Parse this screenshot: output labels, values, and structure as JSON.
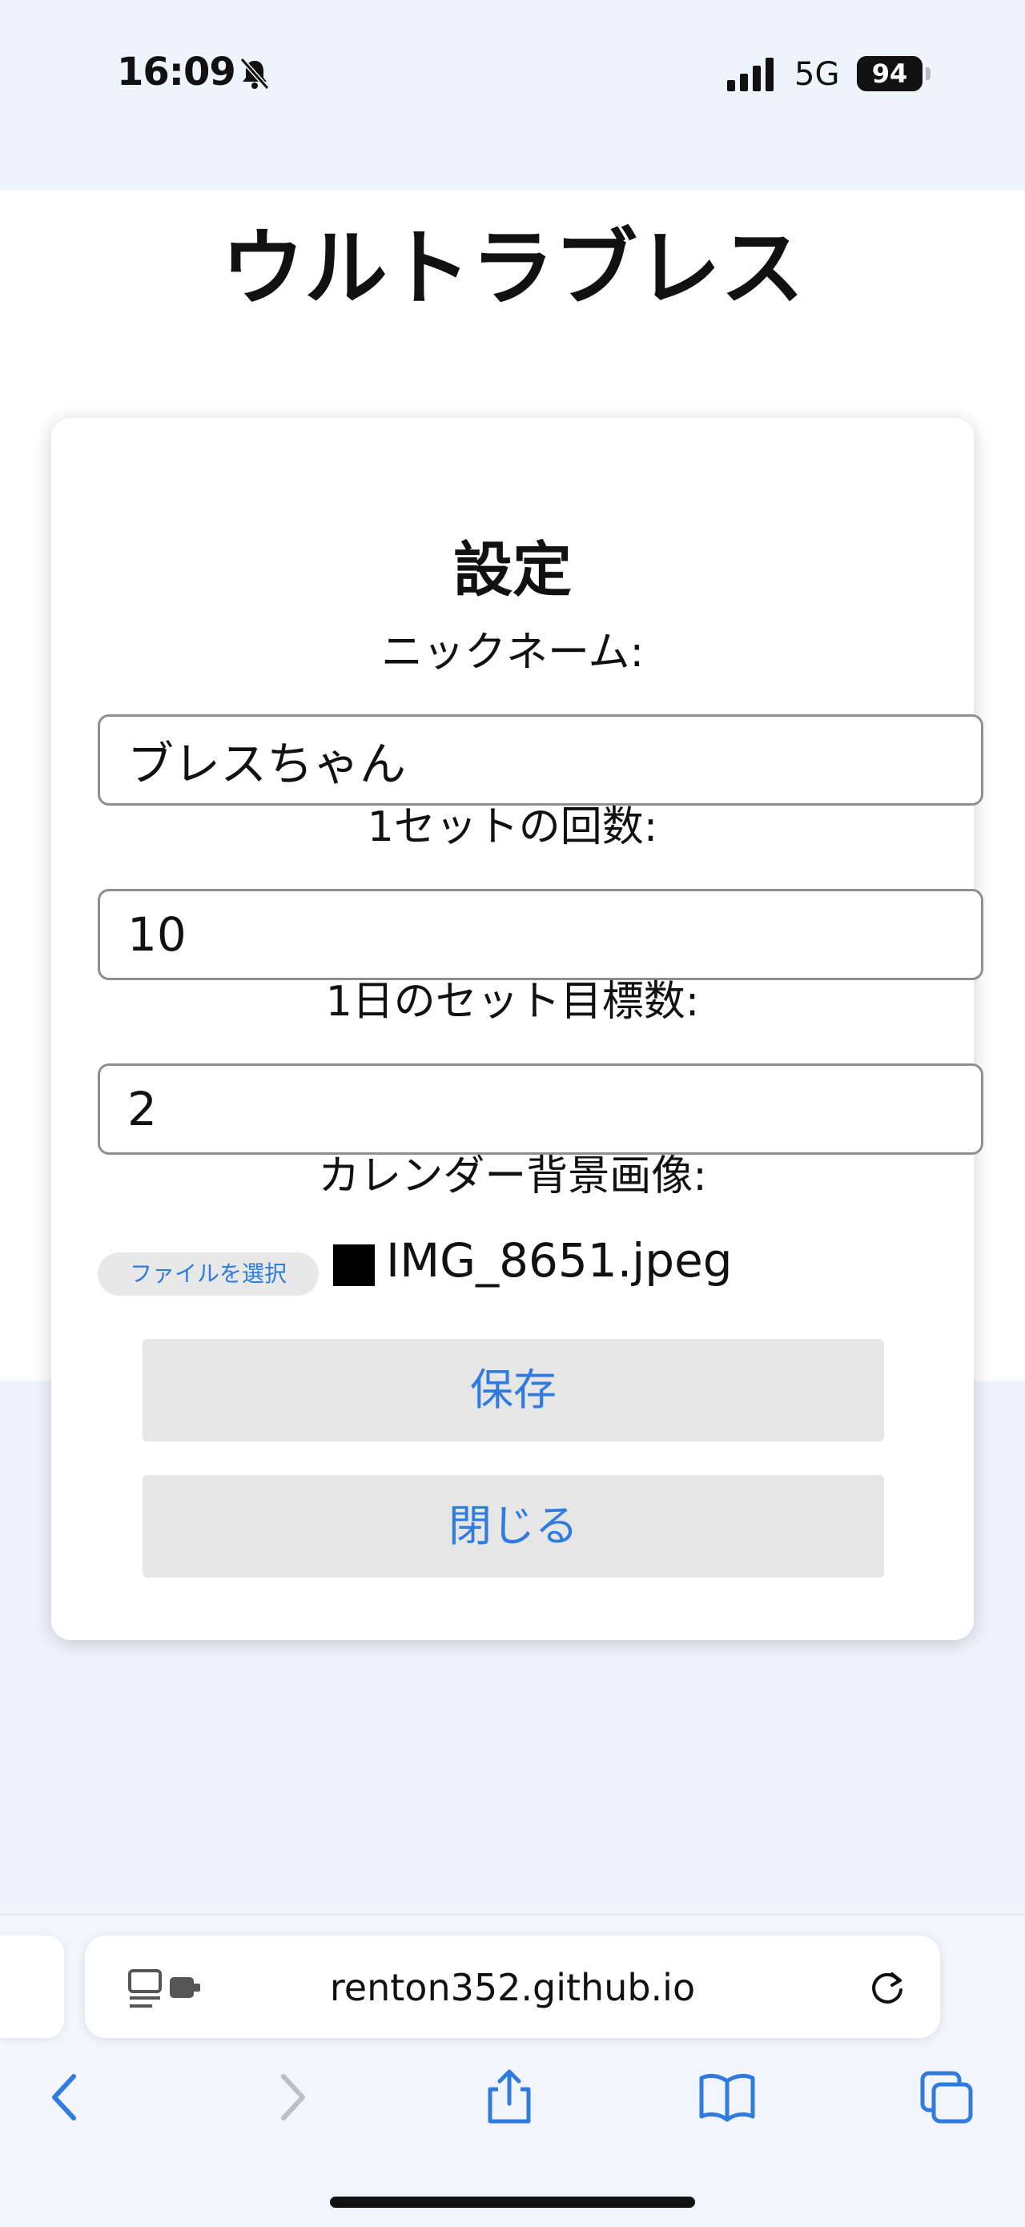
{
  "status_bar": {
    "time": "16:09",
    "network": "5G",
    "battery": "94",
    "icons": [
      "bell-slash-icon",
      "signal-bars-icon",
      "battery-icon"
    ]
  },
  "app": {
    "title": "ウルトラブレス"
  },
  "settings": {
    "title": "設定",
    "nickname": {
      "label": "ニックネーム:",
      "value": "ブレスちゃん"
    },
    "reps_per_set": {
      "label": "1セットの回数:",
      "value": "10"
    },
    "daily_sets": {
      "label": "1日のセット目標数:",
      "value": "2"
    },
    "background": {
      "label": "カレンダー背景画像:",
      "button": "ファイルを選択",
      "file_name": "IMG_8651.jpeg"
    },
    "save_label": "保存",
    "close_label": "閉じる"
  },
  "browser": {
    "url": "renton352.github.io",
    "toolbar_icons": [
      "back-icon",
      "forward-icon",
      "share-icon",
      "bookmarks-icon",
      "tabs-icon"
    ]
  },
  "colors": {
    "accent": "#2f7be0",
    "page_bg": "#eef4fc",
    "button_bg": "#e6e6e6"
  }
}
